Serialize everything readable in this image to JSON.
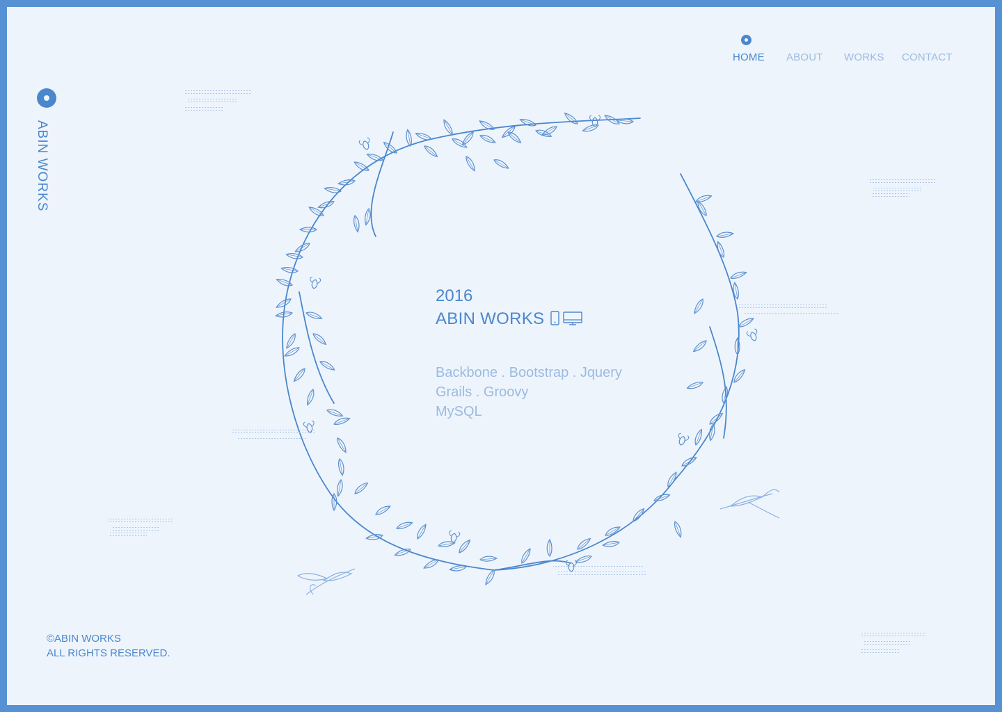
{
  "nav": {
    "items": [
      {
        "label": "HOME",
        "active": true
      },
      {
        "label": "ABOUT",
        "active": false
      },
      {
        "label": "WORKS",
        "active": false
      },
      {
        "label": "CONTACT",
        "active": false
      }
    ]
  },
  "sidebar": {
    "brand": "ABIN WORKS"
  },
  "hero": {
    "year": "2016",
    "title": "ABIN WORKS",
    "icons": [
      "mobile-icon",
      "desktop-icon"
    ],
    "tech_lines": [
      "Backbone . Bootstrap . Jquery",
      "Grails . Groovy",
      "MySQL"
    ]
  },
  "footer": {
    "copyright": "©ABIN WORKS",
    "rights": "ALL RIGHTS RESERVED."
  },
  "colors": {
    "frame": "#5591d3",
    "background": "#eef4fc",
    "primary": "#4a87cc",
    "muted": "#9bbbe1"
  }
}
